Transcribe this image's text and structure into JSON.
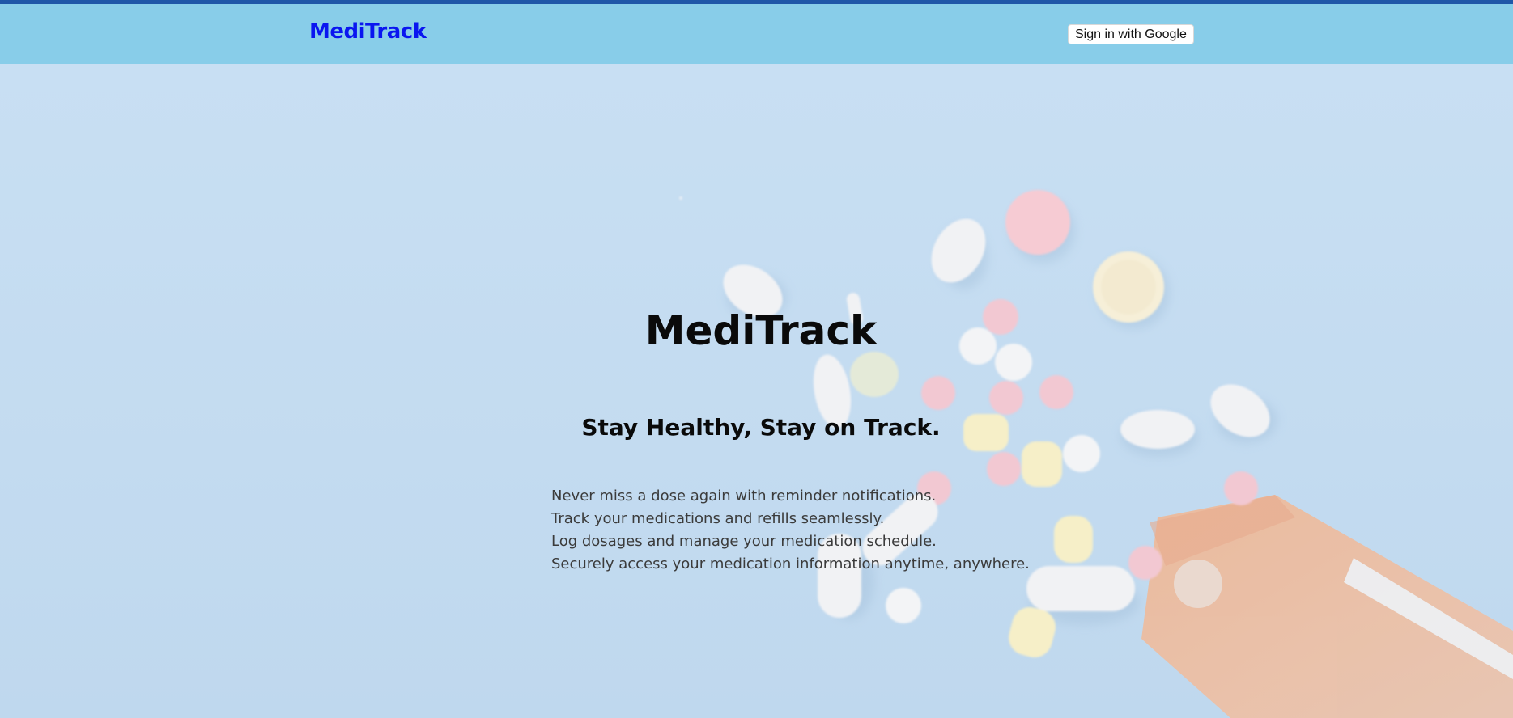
{
  "navbar": {
    "brand": "MediTrack",
    "signin_label": "Sign in with Google"
  },
  "hero": {
    "title": "MediTrack",
    "tagline": "Stay Healthy, Stay on Track.",
    "features": [
      "Never miss a dose again with reminder notifications.",
      "Track your medications and refills seamlessly.",
      "Log dosages and manage your medication schedule.",
      "Securely access your medication information anytime, anywhere."
    ],
    "background_image": "pills-spilling-from-bottle-photo"
  },
  "colors": {
    "top_stripe": "#1f57a8",
    "navbar": "#88cde9",
    "brand": "#0a16f0",
    "hero_background": "#c6dff2"
  }
}
